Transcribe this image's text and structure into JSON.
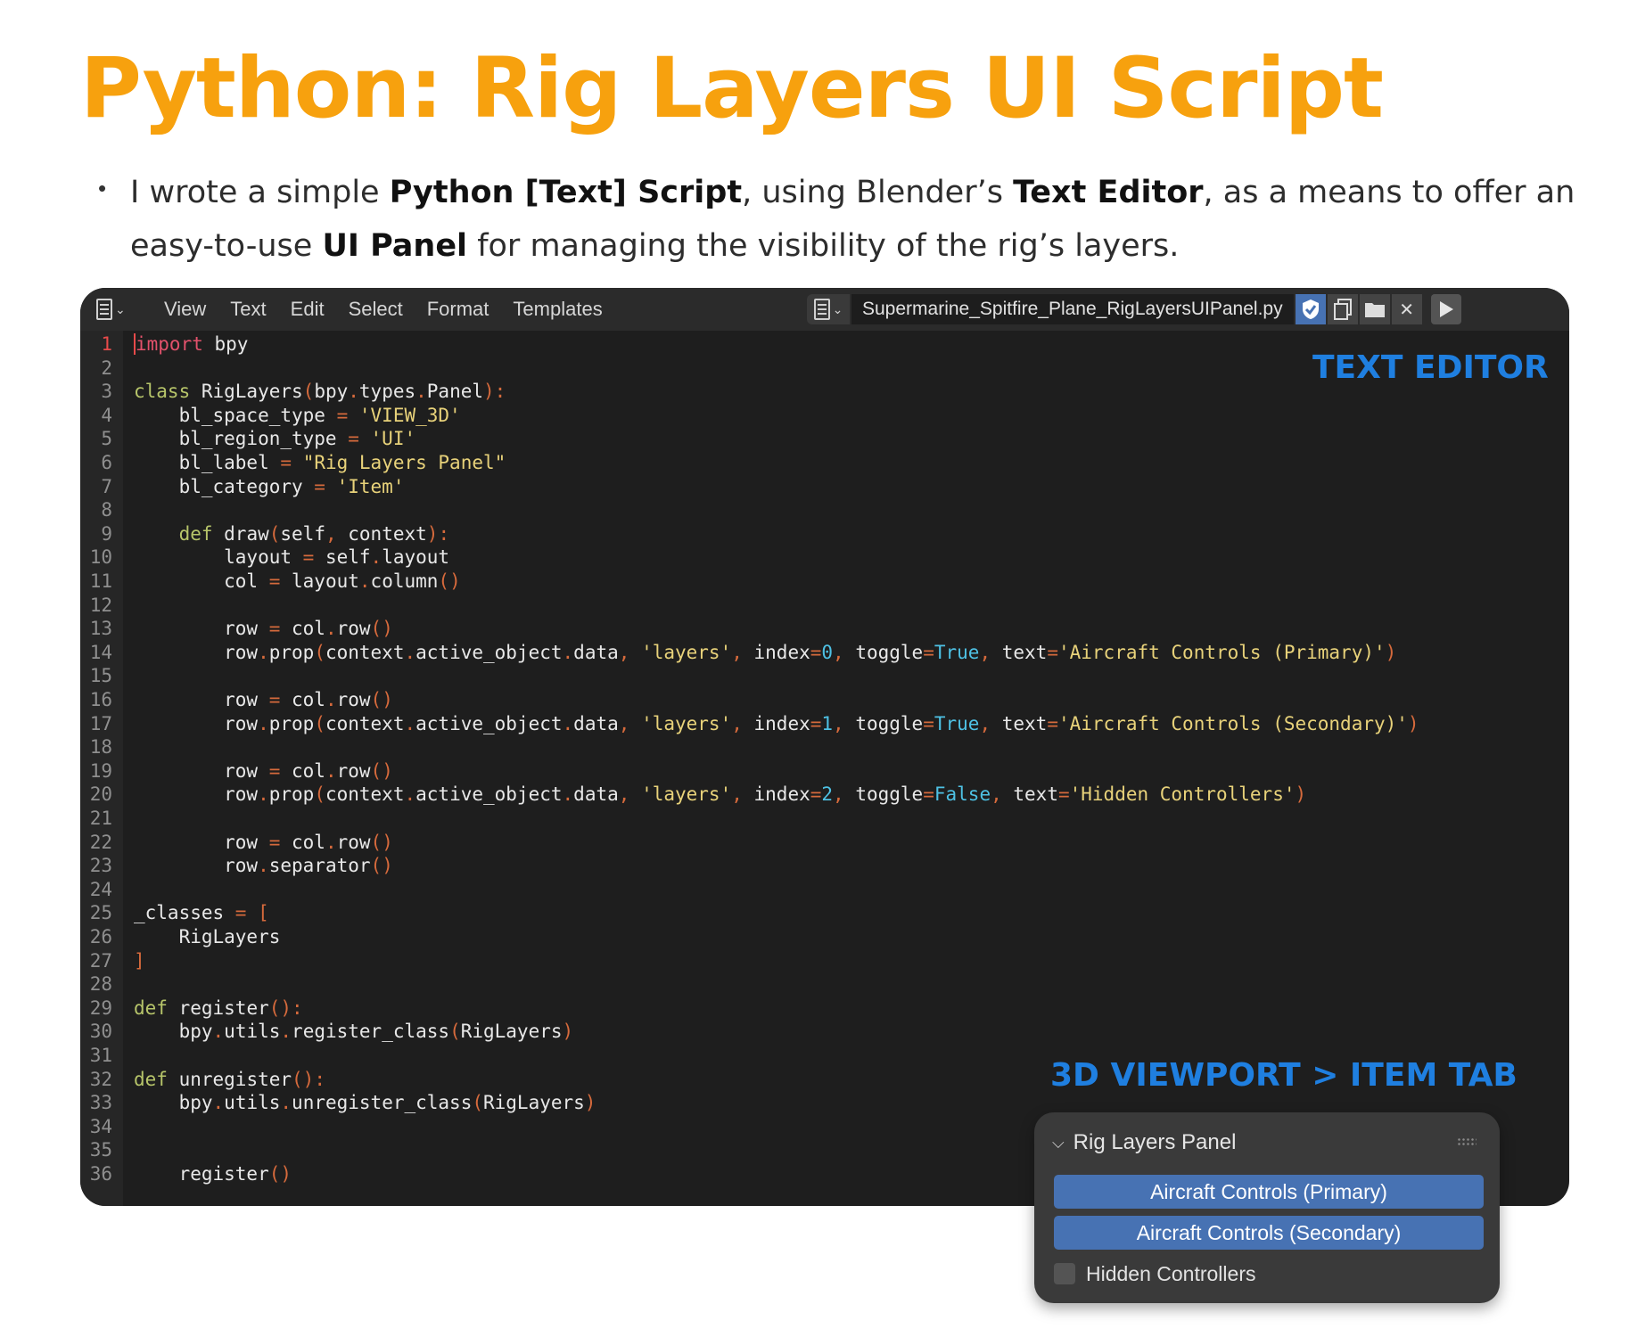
{
  "title": "Python: Rig Layers UI Script",
  "bullet": {
    "t1": "I wrote a simple ",
    "b1": "Python [Text] Script",
    "t2": ", using Blender’s ",
    "b2": "Text Editor",
    "t3": ", as a means to offer an easy-to-use ",
    "b3": "UI Panel",
    "t4": " for managing the visibility of the rig’s layers."
  },
  "editor": {
    "menu": [
      "View",
      "Text",
      "Edit",
      "Select",
      "Format",
      "Templates"
    ],
    "filename": "Supermarine_Spitfire_Plane_RigLayersUIPanel.py",
    "icons": [
      "text-editor-icon",
      "shield-icon",
      "copy-icon",
      "folder-icon",
      "close-icon",
      "run-script-icon"
    ],
    "colors": {
      "background": "#1e1e1e",
      "keyword": "#b7c56a",
      "import": "#e2516b",
      "string": "#e8d27a",
      "number": "#4ec1e4"
    },
    "code_lines": [
      "import bpy",
      "",
      "class RigLayers(bpy.types.Panel):",
      "    bl_space_type = 'VIEW_3D'",
      "    bl_region_type = 'UI'",
      "    bl_label = \"Rig Layers Panel\"",
      "    bl_category = 'Item'",
      "",
      "    def draw(self, context):",
      "        layout = self.layout",
      "        col = layout.column()",
      "",
      "        row = col.row()",
      "        row.prop(context.active_object.data, 'layers', index=0, toggle=True, text='Aircraft Controls (Primary)')",
      "",
      "        row = col.row()",
      "        row.prop(context.active_object.data, 'layers', index=1, toggle=True, text='Aircraft Controls (Secondary)')",
      "",
      "        row = col.row()",
      "        row.prop(context.active_object.data, 'layers', index=2, toggle=False, text='Hidden Controllers')",
      "",
      "        row = col.row()",
      "        row.separator()",
      "",
      "_classes = [",
      "    RigLayers",
      "]",
      "",
      "def register():",
      "    bpy.utils.register_class(RigLayers)",
      "",
      "def unregister():",
      "    bpy.utils.unregister_class(RigLayers)",
      "",
      "",
      "    register()"
    ]
  },
  "labels": {
    "text_editor": "TEXT EDITOR",
    "viewport": "3D VIEWPORT > ITEM TAB"
  },
  "panel": {
    "title": "Rig Layers Panel",
    "buttons": [
      "Aircraft Controls (Primary)",
      "Aircraft Controls (Secondary)"
    ],
    "checkbox_label": "Hidden Controllers",
    "checkbox_checked": false,
    "accent": "#4772b3"
  }
}
